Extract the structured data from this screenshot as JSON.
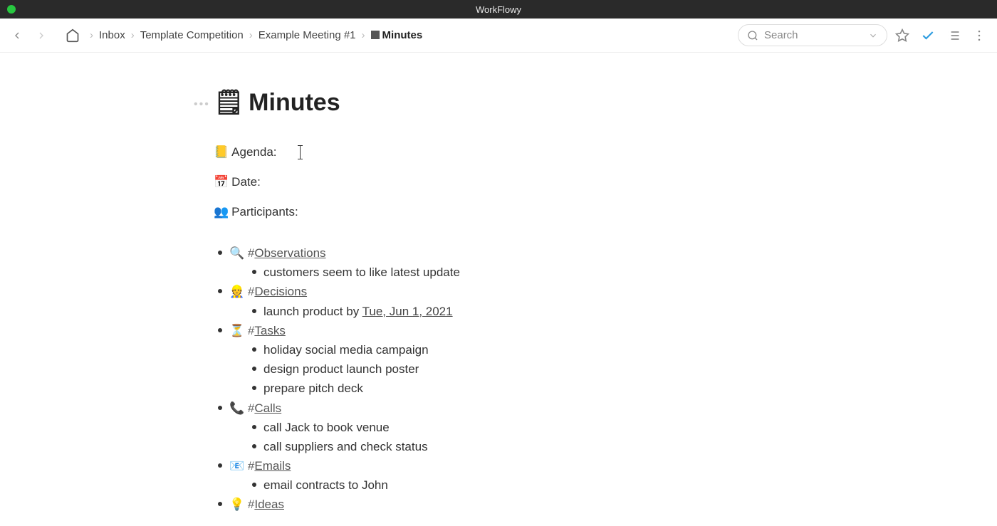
{
  "app": {
    "title": "WorkFlowy"
  },
  "breadcrumb": {
    "items": [
      {
        "label": "Inbox"
      },
      {
        "label": "Template Competition"
      },
      {
        "label": "Example Meeting #1"
      },
      {
        "label": "Minutes",
        "icon": "🗒"
      }
    ]
  },
  "search": {
    "placeholder": "Search"
  },
  "doc": {
    "title_emoji": "🗒",
    "title": "Minutes",
    "meta": [
      {
        "emoji": "📒",
        "label": "Agenda:",
        "has_cursor": true
      },
      {
        "emoji": "📅",
        "label": "Date:"
      },
      {
        "emoji": "👥",
        "label": "Participants:"
      }
    ],
    "sections": [
      {
        "emoji": "🔍",
        "tag": "Observations",
        "items": [
          {
            "text": "customers seem to like latest update"
          }
        ]
      },
      {
        "emoji": "👷",
        "tag": "Decisions",
        "items": [
          {
            "text_before": "launch product by ",
            "date": "Tue, Jun 1, 2021"
          }
        ]
      },
      {
        "emoji": "⏳",
        "tag": "Tasks",
        "items": [
          {
            "text": "holiday social media campaign"
          },
          {
            "text": "design product launch poster"
          },
          {
            "text": "prepare pitch deck"
          }
        ]
      },
      {
        "emoji": "📞",
        "tag": "Calls",
        "items": [
          {
            "text": "call Jack to book venue"
          },
          {
            "text": "call suppliers and check status"
          }
        ]
      },
      {
        "emoji": "📧",
        "tag": "Emails",
        "items": [
          {
            "text": "email contracts to John"
          }
        ]
      },
      {
        "emoji": "💡",
        "tag": "Ideas",
        "items": []
      }
    ]
  }
}
